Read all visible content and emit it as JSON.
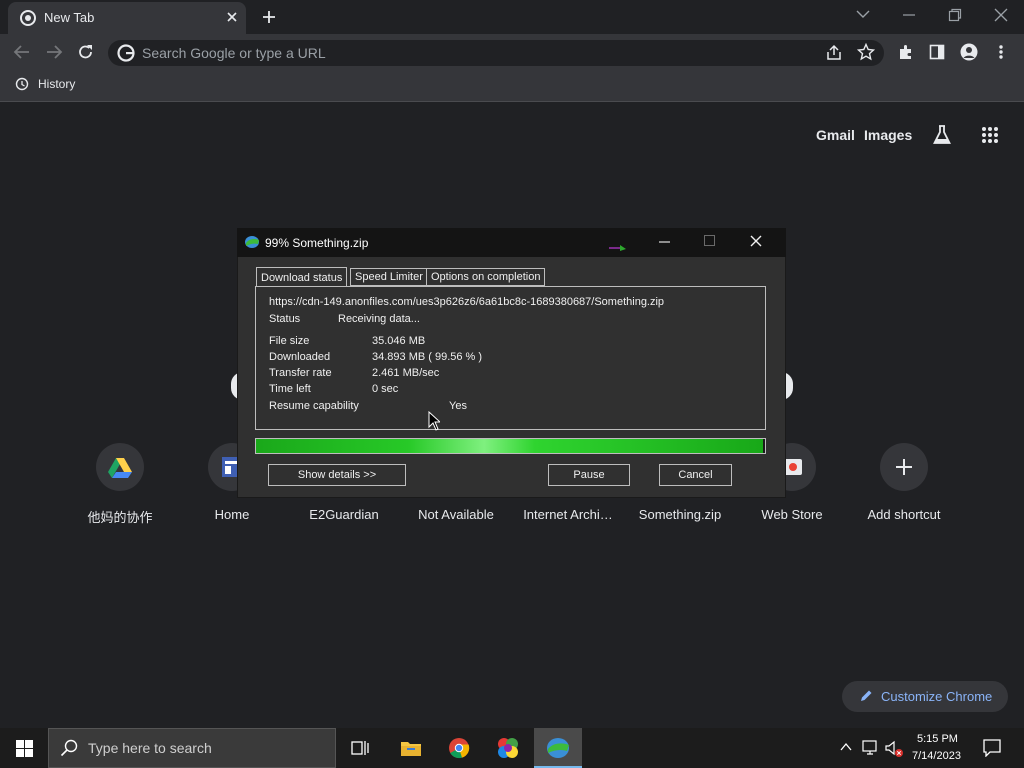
{
  "browser": {
    "tab_title": "New Tab",
    "omnibox_placeholder": "Search Google or type a URL",
    "bookmark": "History",
    "top_links": {
      "gmail": "Gmail",
      "images": "Images"
    }
  },
  "shortcuts": [
    {
      "label": "他妈的协作",
      "icon": "drive-icon"
    },
    {
      "label": "Home",
      "icon": "site-icon"
    },
    {
      "label": "E2Guardian",
      "icon": "globe-icon"
    },
    {
      "label": "Not Available",
      "icon": "globe-icon"
    },
    {
      "label": "Internet Archi…",
      "icon": "archive-icon"
    },
    {
      "label": "Something.zip",
      "icon": "globe-icon"
    },
    {
      "label": "Web Store",
      "icon": "web-store-icon"
    },
    {
      "label": "Add shortcut",
      "icon": "plus-icon"
    }
  ],
  "dialog": {
    "title": "99% Something.zip",
    "tabs": [
      "Download status",
      "Speed Limiter",
      "Options on completion"
    ],
    "url": "https://cdn-149.anonfiles.com/ues3p626z6/6a61bc8c-1689380687/Something.zip",
    "status_label": "Status",
    "status_value": "Receiving data...",
    "rows": [
      {
        "label": "File size",
        "value": "35.046  MB"
      },
      {
        "label": "Downloaded",
        "value": "34.893  MB  ( 99.56 % )"
      },
      {
        "label": "Transfer rate",
        "value": "2.461  MB/sec"
      },
      {
        "label": "Time left",
        "value": "0 sec"
      }
    ],
    "resume_label": "Resume capability",
    "resume_value": "Yes",
    "progress": 0.9956,
    "buttons": {
      "details": "Show details >>",
      "pause": "Pause",
      "cancel": "Cancel"
    }
  },
  "customize": "Customize Chrome",
  "taskbar": {
    "search_placeholder": "Type here to search",
    "time": "5:15 PM",
    "date": "7/14/2023"
  },
  "colors": {
    "accent_blue": "#8ab4f8",
    "progress_green": "#27c927",
    "chrome_bg": "#202124"
  }
}
